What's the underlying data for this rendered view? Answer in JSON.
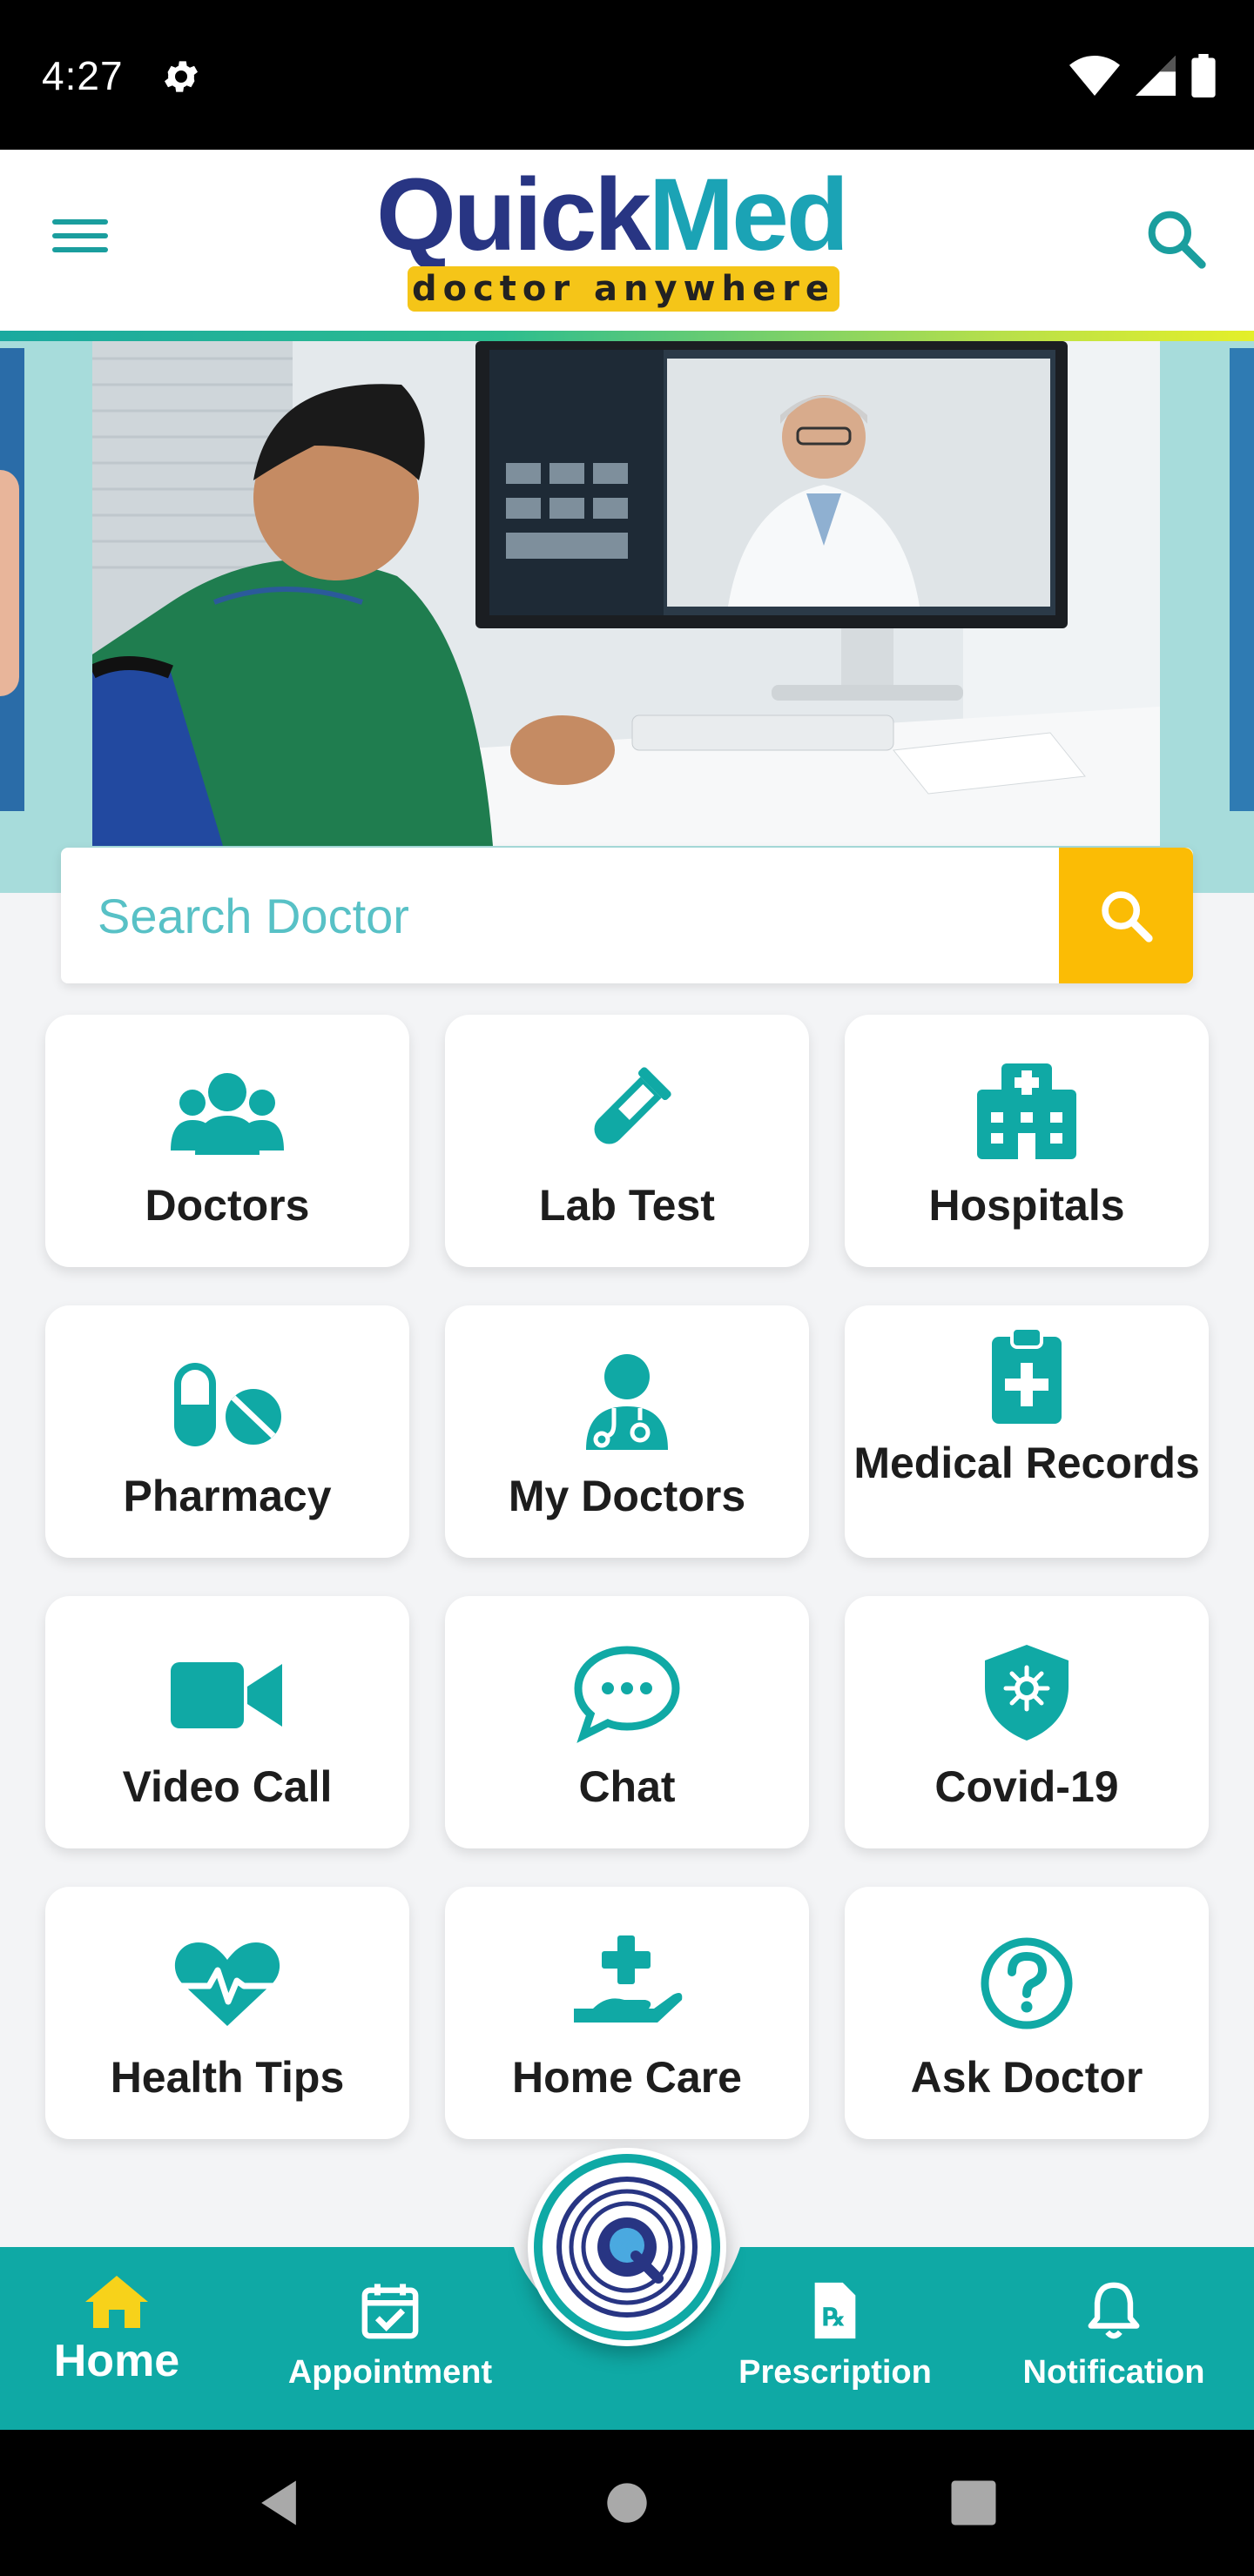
{
  "status_bar": {
    "time": "4:27"
  },
  "header": {
    "logo_primary": "Quick",
    "logo_secondary": "Med",
    "tagline": "doctor anywhere"
  },
  "search": {
    "placeholder": "Search Doctor"
  },
  "services": [
    {
      "label": "Doctors",
      "icon": "users-icon"
    },
    {
      "label": "Lab Test",
      "icon": "test-tube-icon"
    },
    {
      "label": "Hospitals",
      "icon": "hospital-icon"
    },
    {
      "label": "Pharmacy",
      "icon": "pills-icon"
    },
    {
      "label": "My Doctors",
      "icon": "doctor-icon"
    },
    {
      "label": "Medical Records",
      "icon": "clipboard-medical-icon"
    },
    {
      "label": "Video Call",
      "icon": "video-camera-icon"
    },
    {
      "label": "Chat",
      "icon": "chat-bubble-icon"
    },
    {
      "label": "Covid-19",
      "icon": "virus-shield-icon"
    },
    {
      "label": "Health Tips",
      "icon": "heartbeat-icon"
    },
    {
      "label": "Home Care",
      "icon": "hand-medical-icon"
    },
    {
      "label": "Ask Doctor",
      "icon": "question-circle-icon"
    }
  ],
  "bottom_nav": {
    "home": "Home",
    "appointment": "Appointment",
    "prescription": "Prescription",
    "notification": "Notification"
  },
  "colors": {
    "primary": "#0FA9A5",
    "accent": "#FBBC05",
    "logo_dark": "#283583"
  }
}
